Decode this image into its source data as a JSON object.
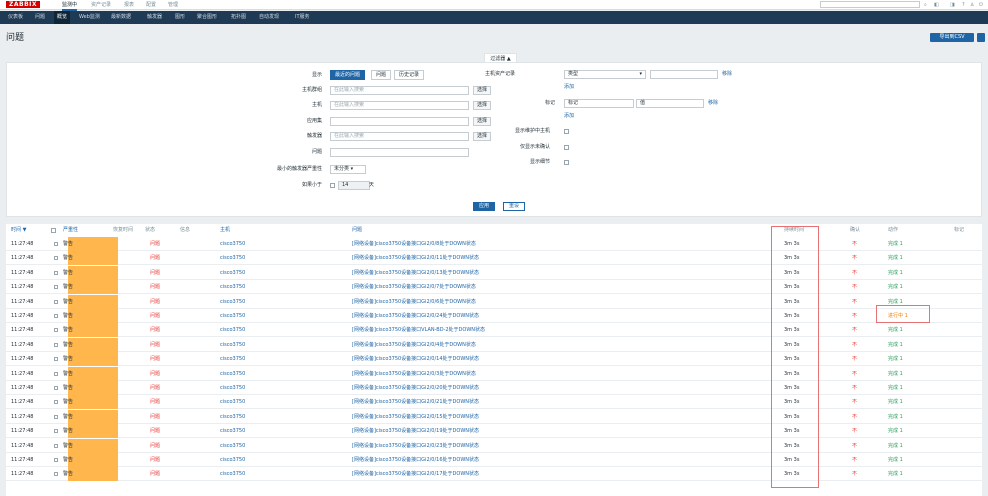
{
  "header": {
    "logo": "ZABBIX",
    "nav": [
      "监测中",
      "资产记录",
      "报表",
      "配置",
      "管理"
    ],
    "active_nav": 0,
    "icons": [
      "search-icon",
      "support-icon",
      "share-icon",
      "help-icon",
      "user-icon",
      "logout-icon"
    ]
  },
  "subnav": {
    "items": [
      "仪表板",
      "问题",
      "概览",
      "Web监测",
      "最新数据",
      "触发器",
      "图形",
      "聚合图形",
      "拓扑图",
      "自动发现",
      "IT服务"
    ],
    "active": 2
  },
  "page": {
    "title": "问题",
    "export_label": "导出到CSV"
  },
  "filter": {
    "tab_label": "过滤器 ▲",
    "show_label": "显示",
    "show_options": [
      "最近的问题",
      "问题",
      "历史记录"
    ],
    "show_active": 0,
    "host_groups_label": "主机群组",
    "host_groups_placeholder": "在此输入搜索",
    "hosts_label": "主机",
    "hosts_placeholder": "在此输入搜索",
    "application_label": "应用集",
    "triggers_label": "触发器",
    "triggers_placeholder": "在此输入搜索",
    "problem_label": "问题",
    "min_severity_label": "最小的触发器严重性",
    "min_severity_value": "未分类",
    "age_label": "如果小于",
    "age_value": "14",
    "age_unit": "天",
    "select_label": "选择",
    "inventory_label": "主机资产记录",
    "inventory_value": "类型",
    "remove_label": "移除",
    "add_label": "添加",
    "tags_label": "标记",
    "tags_value": "标记",
    "tags_op": "值",
    "show_maintenance_label": "显示维护中主机",
    "show_unack_label": "仅显示未确认",
    "show_details_label": "显示细节",
    "apply_label": "应用",
    "reset_label": "重设"
  },
  "table": {
    "headers": {
      "time": "时间 ▼",
      "severity": "严重性",
      "recovery": "恢复时间",
      "status": "状态",
      "info": "信息",
      "host": "主机",
      "problem": "问题",
      "duration": "持续时间",
      "ack": "确认",
      "actions": "动作",
      "tags": "标记"
    },
    "rows": [
      {
        "time": "11:27:48",
        "severity": "警告",
        "status": "问题",
        "host": "cisco3750",
        "problem": "[网络设备]cisco3750设备接口Gi2/0/8处于DOWN状态",
        "duration": "3m 3s",
        "ack": "不",
        "action": "完成 1"
      },
      {
        "time": "11:27:48",
        "severity": "警告",
        "status": "问题",
        "host": "cisco3750",
        "problem": "[网络设备]cisco3750设备接口Gi2/0/11处于DOWN状态",
        "duration": "3m 3s",
        "ack": "不",
        "action": "完成 1"
      },
      {
        "time": "11:27:48",
        "severity": "警告",
        "status": "问题",
        "host": "cisco3750",
        "problem": "[网络设备]cisco3750设备接口Gi2/0/13处于DOWN状态",
        "duration": "3m 3s",
        "ack": "不",
        "action": "完成 1"
      },
      {
        "time": "11:27:48",
        "severity": "警告",
        "status": "问题",
        "host": "cisco3750",
        "problem": "[网络设备]cisco3750设备接口Gi2/0/7处于DOWN状态",
        "duration": "3m 3s",
        "ack": "不",
        "action": "完成 1"
      },
      {
        "time": "11:27:48",
        "severity": "警告",
        "status": "问题",
        "host": "cisco3750",
        "problem": "[网络设备]cisco3750设备接口Gi2/0/6处于DOWN状态",
        "duration": "3m 3s",
        "ack": "不",
        "action": "完成 1"
      },
      {
        "time": "11:27:48",
        "severity": "警告",
        "status": "问题",
        "host": "cisco3750",
        "problem": "[网络设备]cisco3750设备接口Gi2/0/24处于DOWN状态",
        "duration": "3m 3s",
        "ack": "不",
        "action": "进行中 1",
        "action_highlight": true
      },
      {
        "time": "11:27:48",
        "severity": "警告",
        "status": "问题",
        "host": "cisco3750",
        "problem": "[网络设备]cisco3750设备接口VLAN-BD-2处于DOWN状态",
        "duration": "3m 3s",
        "ack": "不",
        "action": "完成 1"
      },
      {
        "time": "11:27:48",
        "severity": "警告",
        "status": "问题",
        "host": "cisco3750",
        "problem": "[网络设备]cisco3750设备接口Gi2/0/4处于DOWN状态",
        "duration": "3m 3s",
        "ack": "不",
        "action": "完成 1"
      },
      {
        "time": "11:27:48",
        "severity": "警告",
        "status": "问题",
        "host": "cisco3750",
        "problem": "[网络设备]cisco3750设备接口Gi2/0/14处于DOWN状态",
        "duration": "3m 3s",
        "ack": "不",
        "action": "完成 1"
      },
      {
        "time": "11:27:48",
        "severity": "警告",
        "status": "问题",
        "host": "cisco3750",
        "problem": "[网络设备]cisco3750设备接口Gi2/0/3处于DOWN状态",
        "duration": "3m 3s",
        "ack": "不",
        "action": "完成 1"
      },
      {
        "time": "11:27:48",
        "severity": "警告",
        "status": "问题",
        "host": "cisco3750",
        "problem": "[网络设备]cisco3750设备接口Gi2/0/20处于DOWN状态",
        "duration": "3m 3s",
        "ack": "不",
        "action": "完成 1"
      },
      {
        "time": "11:27:48",
        "severity": "警告",
        "status": "问题",
        "host": "cisco3750",
        "problem": "[网络设备]cisco3750设备接口Gi2/0/21处于DOWN状态",
        "duration": "3m 3s",
        "ack": "不",
        "action": "完成 1"
      },
      {
        "time": "11:27:48",
        "severity": "警告",
        "status": "问题",
        "host": "cisco3750",
        "problem": "[网络设备]cisco3750设备接口Gi2/0/15处于DOWN状态",
        "duration": "3m 3s",
        "ack": "不",
        "action": "完成 1"
      },
      {
        "time": "11:27:48",
        "severity": "警告",
        "status": "问题",
        "host": "cisco3750",
        "problem": "[网络设备]cisco3750设备接口Gi2/0/19处于DOWN状态",
        "duration": "3m 3s",
        "ack": "不",
        "action": "完成 1"
      },
      {
        "time": "11:27:48",
        "severity": "警告",
        "status": "问题",
        "host": "cisco3750",
        "problem": "[网络设备]cisco3750设备接口Gi2/0/23处于DOWN状态",
        "duration": "3m 3s",
        "ack": "不",
        "action": "完成 1"
      },
      {
        "time": "11:27:48",
        "severity": "警告",
        "status": "问题",
        "host": "cisco3750",
        "problem": "[网络设备]cisco3750设备接口Gi2/0/16处于DOWN状态",
        "duration": "3m 3s",
        "ack": "不",
        "action": "完成 1"
      },
      {
        "time": "11:27:48",
        "severity": "警告",
        "status": "问题",
        "host": "cisco3750",
        "problem": "[网络设备]cisco3750设备接口Gi2/0/17处于DOWN状态",
        "duration": "3m 3s",
        "ack": "不",
        "action": "完成 1"
      }
    ]
  },
  "colors": {
    "accent": "#1f65a6",
    "nav_bg": "#1f3a54",
    "severity_warning": "#ffb74d",
    "problem_red": "#e53935",
    "done_green": "#31a05f",
    "in_progress_orange": "#f57c00",
    "annotation_red": "#e57373"
  }
}
